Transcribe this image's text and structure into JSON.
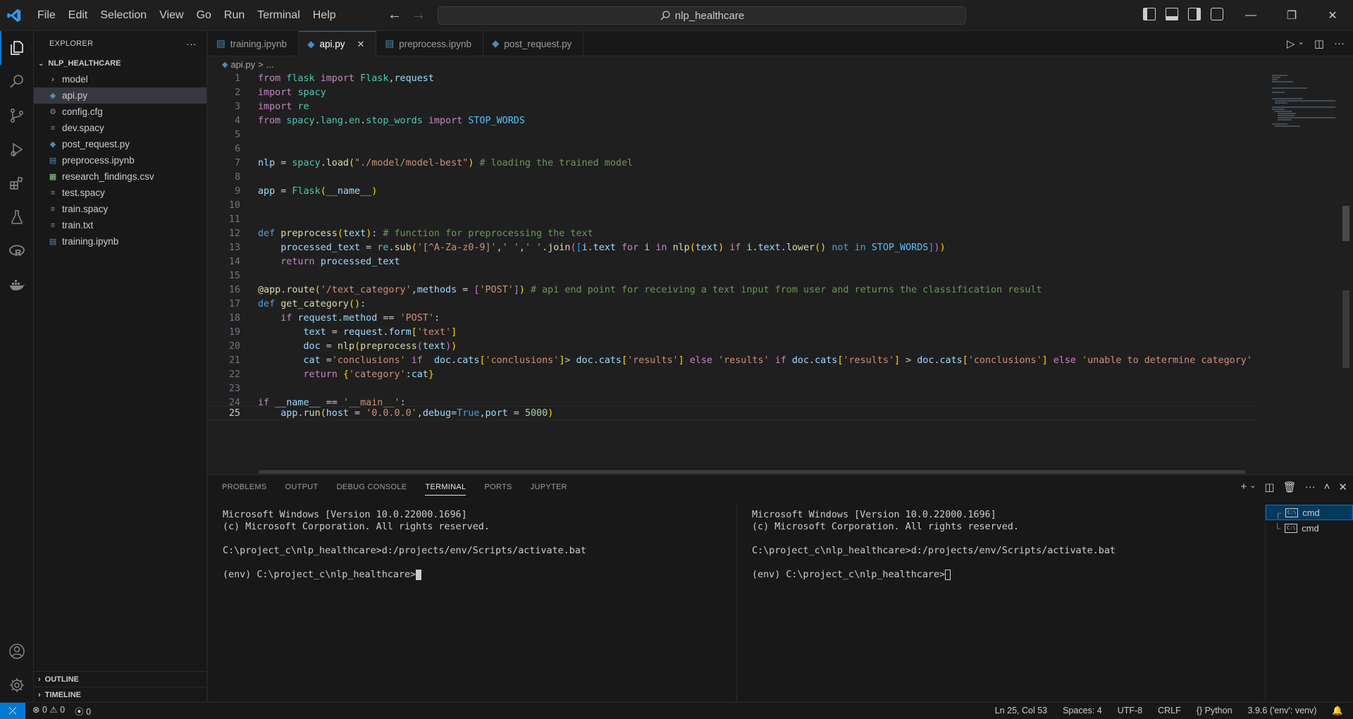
{
  "window": {
    "menu": [
      "File",
      "Edit",
      "Selection",
      "View",
      "Go",
      "Run",
      "Terminal",
      "Help"
    ],
    "search_text": "nlp_healthcare",
    "accent": "#0078d4"
  },
  "sidebar": {
    "title": "EXPLORER",
    "more": "···",
    "folder": "NLP_HEALTHCARE",
    "items": [
      {
        "label": "model",
        "type": "folder"
      },
      {
        "label": "api.py",
        "type": "python"
      },
      {
        "label": "config.cfg",
        "type": "gear"
      },
      {
        "label": "dev.spacy",
        "type": "file"
      },
      {
        "label": "post_request.py",
        "type": "python"
      },
      {
        "label": "preprocess.ipynb",
        "type": "notebook"
      },
      {
        "label": "research_findings.csv",
        "type": "csv"
      },
      {
        "label": "test.spacy",
        "type": "file"
      },
      {
        "label": "train.spacy",
        "type": "file"
      },
      {
        "label": "train.txt",
        "type": "text"
      },
      {
        "label": "training.ipynb",
        "type": "notebook"
      }
    ],
    "outline": "OUTLINE",
    "timeline": "TIMELINE"
  },
  "tabs": [
    {
      "label": "training.ipynb",
      "active": false
    },
    {
      "label": "api.py",
      "active": true
    },
    {
      "label": "preprocess.ipynb",
      "active": false
    },
    {
      "label": "post_request.py",
      "active": false
    }
  ],
  "breadcrumb": {
    "file": "api.py",
    "sep": ">",
    "rest": "..."
  },
  "editor": {
    "line_numbers": [
      "1",
      "2",
      "3",
      "4",
      "5",
      "6",
      "7",
      "8",
      "9",
      "10",
      "11",
      "12",
      "13",
      "14",
      "15",
      "16",
      "17",
      "18",
      "19",
      "20",
      "21",
      "22",
      "23",
      "24",
      "25"
    ],
    "current_line": 25
  },
  "panel": {
    "tabs": [
      "PROBLEMS",
      "OUTPUT",
      "DEBUG CONSOLE",
      "TERMINAL",
      "PORTS",
      "JUPYTER"
    ],
    "active_tab": "TERMINAL",
    "terminal_left": {
      "line1": "Microsoft Windows [Version 10.0.22000.1696]",
      "line2": "(c) Microsoft Corporation. All rights reserved.",
      "line3": "C:\\project_c\\nlp_healthcare>d:/projects/env/Scripts/activate.bat",
      "line4": "(env) C:\\project_c\\nlp_healthcare>"
    },
    "terminal_right": {
      "line1": "Microsoft Windows [Version 10.0.22000.1696]",
      "line2": "(c) Microsoft Corporation. All rights reserved.",
      "line3": "C:\\project_c\\nlp_healthcare>d:/projects/env/Scripts/activate.bat",
      "line4": "(env) C:\\project_c\\nlp_healthcare>"
    },
    "terminals": [
      "cmd",
      "cmd"
    ]
  },
  "status": {
    "errors": "0",
    "warnings": "0",
    "ports": "0",
    "position": "Ln 25, Col 53",
    "spaces": "Spaces: 4",
    "encoding": "UTF-8",
    "eol": "CRLF",
    "language": "Python",
    "interpreter": "3.9.6 ('env': venv)"
  }
}
